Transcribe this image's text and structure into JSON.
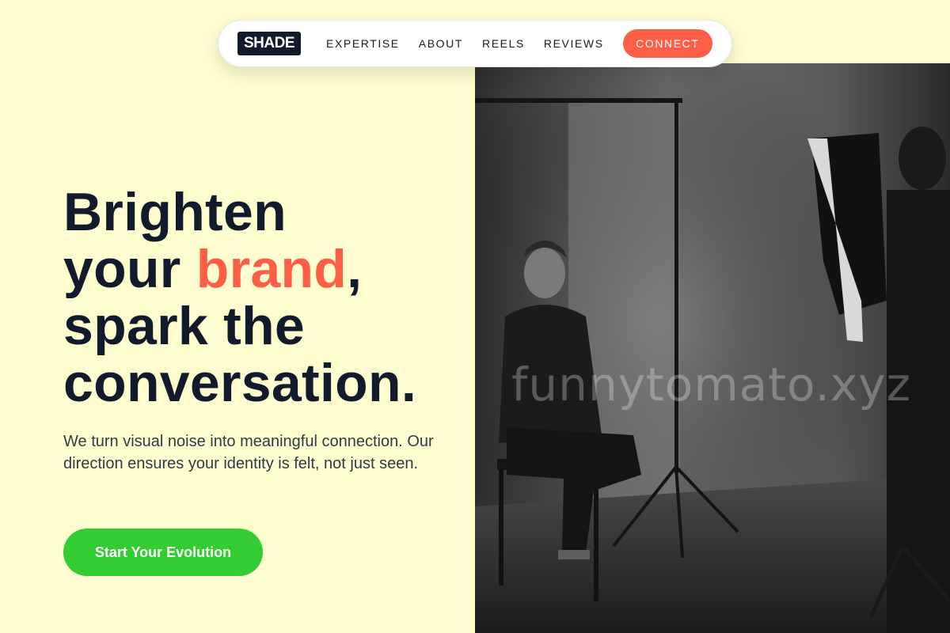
{
  "nav": {
    "logo": "SHADE",
    "links": [
      "EXPERTISE",
      "ABOUT",
      "REELS",
      "REVIEWS"
    ],
    "connect_label": "CONNECT"
  },
  "hero": {
    "headline_line1": "Brighten",
    "headline_line2_pre": "your ",
    "headline_accent": "brand",
    "headline_line2_post": ",",
    "headline_line3": "spark the",
    "headline_line4": "conversation.",
    "subtitle": "We turn visual noise into meaningful connection. Our direction ensures your identity is felt, not just seen.",
    "cta_label": "Start Your Evolution",
    "photo": "black-and-white studio photo of a man seated on a stool beside a softbox light and a photographer"
  },
  "watermark": "funnytomato.xyz",
  "colors": {
    "background": "#fefdd0",
    "accent": "#fc5f45",
    "cta": "#33cc33",
    "dark": "#121a2b"
  }
}
